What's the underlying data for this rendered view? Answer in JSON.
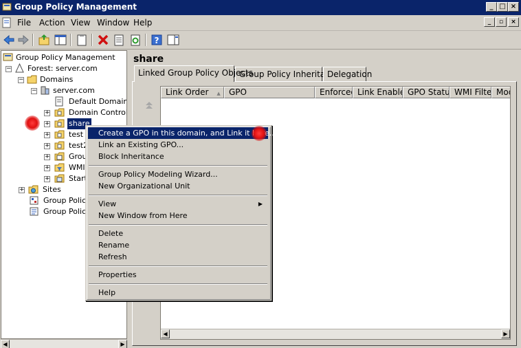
{
  "window": {
    "title": "Group Policy Management"
  },
  "menu": [
    "File",
    "Action",
    "View",
    "Window",
    "Help"
  ],
  "tree": {
    "root": "Group Policy Management",
    "forest": "Forest: server.com",
    "domains": "Domains",
    "domain": "server.com",
    "children": [
      "Default Domain Po",
      "Domain Controller",
      "share",
      "test",
      "test2",
      "Grou",
      "WMI",
      "Start"
    ],
    "sites": "Sites",
    "modeling": "Group Policy",
    "results": "Group Policy"
  },
  "right": {
    "title": "share",
    "tabs": [
      "Linked Group Policy Objects",
      "Group Policy Inheritance",
      "Delegation"
    ],
    "columns": [
      "Link Order",
      "GPO",
      "Enforced",
      "Link Enabled",
      "GPO Status",
      "WMI Filter",
      "Modi"
    ]
  },
  "context_menu": {
    "items": [
      "Create a GPO in this domain, and Link it here...",
      "Link an Existing GPO...",
      "Block Inheritance",
      "Group Policy Modeling Wizard...",
      "New Organizational Unit",
      "View",
      "New Window from Here",
      "Delete",
      "Rename",
      "Refresh",
      "Properties",
      "Help"
    ]
  },
  "colors": {
    "titlebar": "#0a246a",
    "highlight": "#0a246a",
    "chrome": "#d4d0c8"
  }
}
